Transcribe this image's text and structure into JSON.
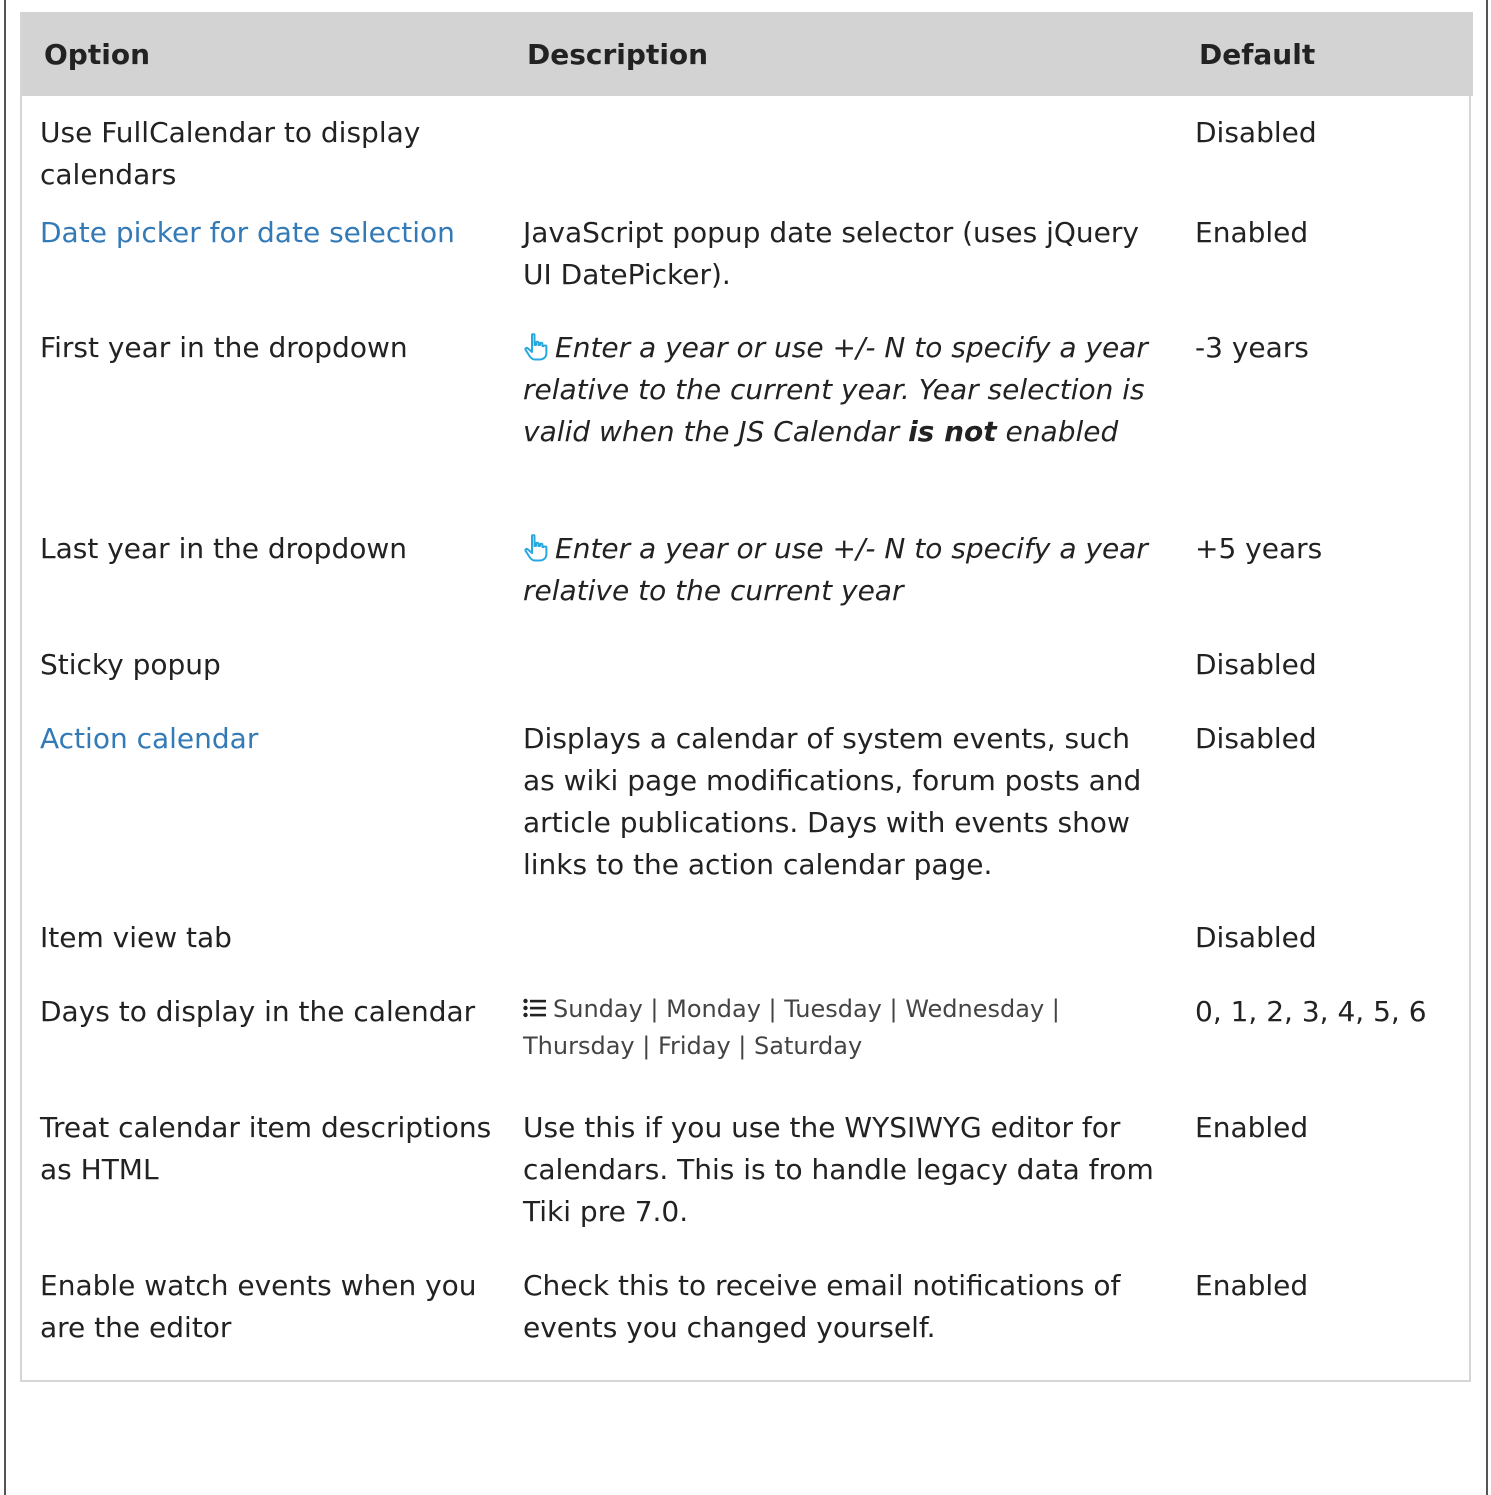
{
  "table": {
    "headers": [
      "Option",
      "Description",
      "Default"
    ],
    "rows": [
      {
        "option": "Use FullCalendar to display calendars",
        "description": "",
        "default": "Disabled"
      },
      {
        "option": "Date picker for date selection",
        "option_is_link": true,
        "description": "JavaScript popup date selector (uses jQuery UI DatePicker).",
        "default": "Enabled"
      },
      {
        "option": "First year in the dropdown",
        "description_pre": "Enter a year or use +/- N to specify a year relative to the current year. Year selection is valid when the JS Calendar ",
        "description_bold": "is not",
        "description_post": " enabled",
        "description_icon": "hand-pointer-icon",
        "default": "-3 years"
      },
      {
        "option": "Last year in the dropdown",
        "description": "Enter a year or use +/- N to specify a year relative to the current year",
        "description_icon": "hand-pointer-icon",
        "default": "+5 years"
      },
      {
        "option": "Sticky popup",
        "description": "",
        "default": "Disabled"
      },
      {
        "option": "Action calendar",
        "option_is_link": true,
        "description": "Displays a calendar of system events, such as wiki page modifications, forum posts and article publications. Days with events show links to the action calendar page.",
        "default": "Disabled"
      },
      {
        "option": "Item view tab",
        "description": "",
        "default": "Disabled"
      },
      {
        "option": "Days to display in the calendar",
        "description": "Sunday | Monday | Tuesday | Wednesday | Thursday | Friday | Saturday",
        "description_icon": "list-icon",
        "default": "0, 1, 2, 3, 4, 5, 6"
      },
      {
        "option": "Treat calendar item descriptions as HTML",
        "description": "Use this if you use the WYSIWYG editor for calendars. This is to handle legacy data from Tiki pre 7.0.",
        "default": "Enabled"
      },
      {
        "option": "Enable watch events when you are the editor",
        "description": "Check this to receive email notifications of events you changed yourself.",
        "default": "Enabled"
      }
    ]
  },
  "colors": {
    "header_bg": "#d3d3d3",
    "link": "#337ab7",
    "icon": "#29a8e0"
  }
}
